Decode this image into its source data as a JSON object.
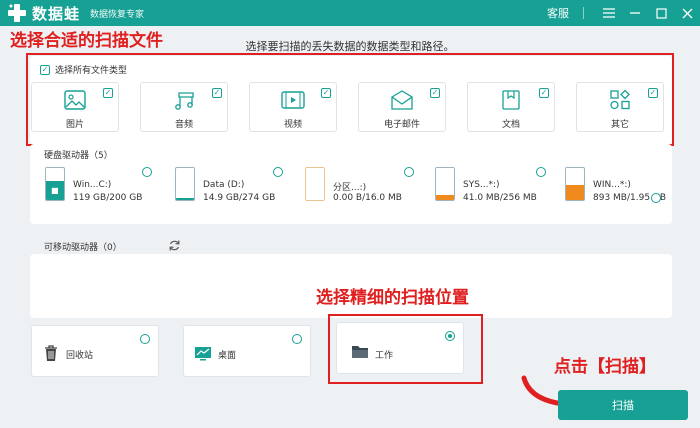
{
  "app": {
    "name": "数据蛙",
    "tagline": "数据恢复专家",
    "kefu": "客服",
    "brand_color": "#17a194",
    "annotation_color": "#e02020"
  },
  "annotations": {
    "top": "选择合适的扫描文件",
    "middle": "选择精细的扫描位置",
    "button": "点击【扫描】"
  },
  "instruction": "选择要扫描的丢失数据的数据类型和路径。",
  "file_types": {
    "select_all": "选择所有文件类型",
    "items": [
      {
        "label": "图片",
        "icon": "image-icon",
        "checked": true
      },
      {
        "label": "音频",
        "icon": "music-icon",
        "checked": true
      },
      {
        "label": "视频",
        "icon": "video-icon",
        "checked": true
      },
      {
        "label": "电子邮件",
        "icon": "email-icon",
        "checked": true
      },
      {
        "label": "文档",
        "icon": "document-icon",
        "checked": true
      },
      {
        "label": "其它",
        "icon": "other-icon",
        "checked": true
      }
    ]
  },
  "hard_drives": {
    "title": "硬盘驱动器（5）",
    "items": [
      {
        "name": "Win...C:)",
        "size": "119 GB/200 GB",
        "used_fraction": 0.6,
        "fill_color": "#17a194",
        "os_icon": true
      },
      {
        "name": "Data (D:)",
        "size": "14.9 GB/274 GB",
        "used_fraction": 0.05,
        "fill_color": "#17a194",
        "os_icon": false
      },
      {
        "name": "分区...:)",
        "size": "0.00  B/16.0 MB",
        "used_fraction": 0.0,
        "fill_color": "#17a194",
        "os_icon": false
      },
      {
        "name": "SYS...*:)",
        "size": "41.0 MB/256 MB",
        "used_fraction": 0.16,
        "fill_color": "#f08a1c",
        "os_icon": false
      },
      {
        "name": "WIN...*:)",
        "size": "893 MB/1.95 GB",
        "used_fraction": 0.46,
        "fill_color": "#f08a1c",
        "os_icon": false
      }
    ]
  },
  "removable": {
    "title": "可移动驱动器（0）",
    "refresh_icon": "refresh-icon"
  },
  "locations": [
    {
      "label": "回收站",
      "icon": "recycle-bin-icon",
      "selected": false
    },
    {
      "label": "桌面",
      "icon": "desktop-icon",
      "selected": false
    },
    {
      "label": "工作",
      "icon": "folder-icon",
      "selected": true
    }
  ],
  "scan_button": "扫描"
}
